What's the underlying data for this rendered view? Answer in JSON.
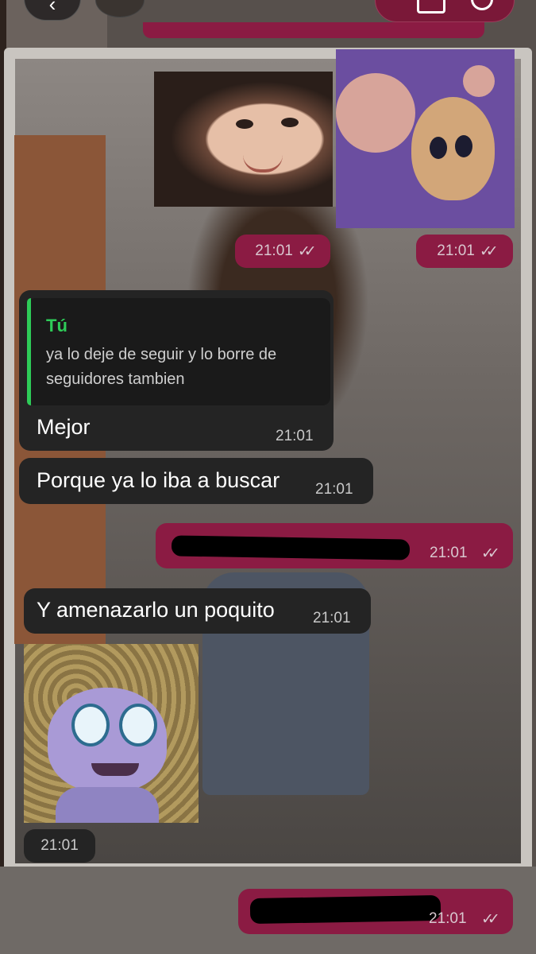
{
  "chat": {
    "quoted_author": "Tú",
    "quoted_text": "ya lo deje de seguir y lo borre de seguidores tambien",
    "messages": [
      {
        "direction": "out",
        "type": "image",
        "time": "21:01",
        "status": "read"
      },
      {
        "direction": "out",
        "type": "image",
        "time": "21:01",
        "status": "read"
      },
      {
        "direction": "in",
        "type": "text",
        "text": "Mejor",
        "time": "21:01"
      },
      {
        "direction": "in",
        "type": "text",
        "text": "Porque ya lo iba a buscar",
        "time": "21:01"
      },
      {
        "direction": "out",
        "type": "text",
        "text": "",
        "time": "21:01",
        "status": "read"
      },
      {
        "direction": "in",
        "type": "text",
        "text": "Y amenazarlo un poquito",
        "time": "21:01"
      },
      {
        "direction": "in",
        "type": "image",
        "time": "21:01"
      },
      {
        "direction": "out",
        "type": "text",
        "text": "",
        "time": "21:01",
        "status": "read"
      }
    ],
    "read_ticks": "✓✓"
  },
  "colors": {
    "outgoing_bubble": "#8b1b43",
    "incoming_bubble": "#242424",
    "reply_accent": "#2ecc58"
  },
  "icons": {
    "back": "chevron-left-icon",
    "read_status": "double-check-icon",
    "video_call": "video-camera-icon",
    "voice_call": "phone-icon"
  }
}
